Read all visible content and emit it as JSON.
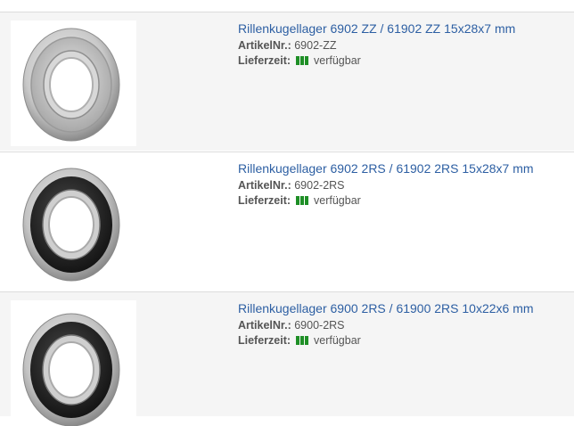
{
  "products": [
    {
      "title": "Rillenkugellager 6902 ZZ / 61902 ZZ 15x28x7 mm",
      "article_label": "ArtikelNr.:",
      "article_no": "6902-ZZ",
      "delivery_label": "Lieferzeit:",
      "availability": "verfügbar",
      "image": "bearing-shielded-zz",
      "availability_color": "#1e8f26"
    },
    {
      "title": "Rillenkugellager 6902 2RS / 61902 2RS 15x28x7 mm",
      "article_label": "ArtikelNr.:",
      "article_no": "6902-2RS",
      "delivery_label": "Lieferzeit:",
      "availability": "verfügbar",
      "image": "bearing-sealed-2rs",
      "availability_color": "#1e8f26"
    },
    {
      "title": "Rillenkugellager 6900 2RS / 61900 2RS 10x22x6 mm",
      "article_label": "ArtikelNr.:",
      "article_no": "6900-2RS",
      "delivery_label": "Lieferzeit:",
      "availability": "verfügbar",
      "image": "bearing-sealed-2rs",
      "availability_color": "#1e8f26"
    }
  ],
  "colors": {
    "link": "#2d5fa3",
    "text": "#555555",
    "row_alt": "#f5f5f5"
  }
}
